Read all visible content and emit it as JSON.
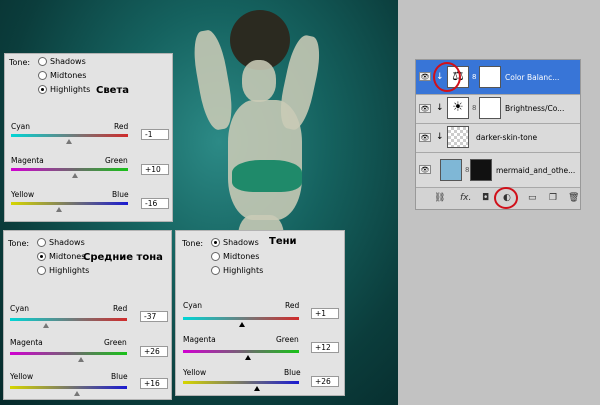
{
  "panels": {
    "highlights": {
      "tone_label": "Tone:",
      "options": [
        "Shadows",
        "Midtones",
        "Highlights"
      ],
      "selected": 2,
      "annotation": "Света",
      "sliders": [
        {
          "left": "Cyan",
          "right": "Red",
          "value": "-1"
        },
        {
          "left": "Magenta",
          "right": "Green",
          "value": "+10"
        },
        {
          "left": "Yellow",
          "right": "Blue",
          "value": "-16"
        }
      ]
    },
    "midtones": {
      "tone_label": "Tone:",
      "options": [
        "Shadows",
        "Midtones",
        "Highlights"
      ],
      "selected": 1,
      "annotation": "Средние тона",
      "sliders": [
        {
          "left": "Cyan",
          "right": "Red",
          "value": "-37"
        },
        {
          "left": "Magenta",
          "right": "Green",
          "value": "+26"
        },
        {
          "left": "Yellow",
          "right": "Blue",
          "value": "+16"
        }
      ]
    },
    "shadows": {
      "tone_label": "Tone:",
      "options": [
        "Shadows",
        "Midtones",
        "Highlights"
      ],
      "selected": 0,
      "annotation": "Тени",
      "sliders": [
        {
          "left": "Cyan",
          "right": "Red",
          "value": "+1"
        },
        {
          "left": "Magenta",
          "right": "Green",
          "value": "+12"
        },
        {
          "left": "Yellow",
          "right": "Blue",
          "value": "+26"
        }
      ]
    }
  },
  "layers": [
    {
      "name": "Color Balanc...",
      "icon": "color-balance-icon",
      "selected": true
    },
    {
      "name": "Brightness/Co...",
      "icon": "brightness-contrast-icon",
      "selected": false
    },
    {
      "name": "darker-skin-tone",
      "icon": "layer-icon",
      "selected": false
    },
    {
      "name": "mermaid_and_othe...",
      "icon": "image-thumbnail-icon",
      "selected": false
    }
  ],
  "layer_toolbar": {
    "items": [
      "link-icon",
      "fx-icon",
      "mask-icon",
      "adjustment-layer-icon",
      "group-icon",
      "new-layer-icon",
      "trash-icon"
    ],
    "fx_label": "fx."
  },
  "accent_colors": {
    "selection": "#3875d7",
    "annotation_ring": "#d0101a"
  }
}
